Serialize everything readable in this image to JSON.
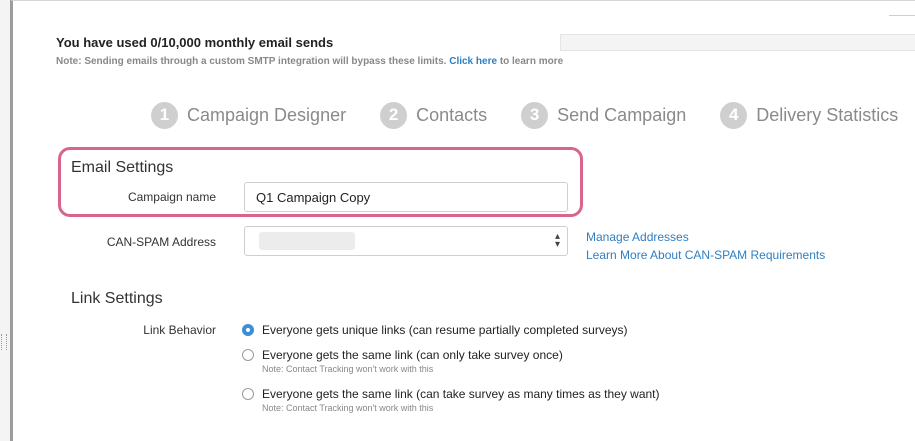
{
  "usage": {
    "title": "You have used 0/10,000 monthly email sends",
    "note_prefix": "Note: Sending emails through a custom SMTP integration will bypass these limits.",
    "note_link": "Click here",
    "note_suffix": "to learn more",
    "progress_fraction": 0.0
  },
  "steps": [
    {
      "number": "1",
      "label": "Campaign Designer"
    },
    {
      "number": "2",
      "label": "Contacts"
    },
    {
      "number": "3",
      "label": "Send Campaign"
    },
    {
      "number": "4",
      "label": "Delivery Statistics"
    }
  ],
  "email_settings": {
    "title": "Email Settings",
    "campaign_name_label": "Campaign name",
    "campaign_name_value": "Q1 Campaign Copy",
    "canspam_label": "CAN-SPAM Address",
    "manage_addresses_link": "Manage Addresses",
    "learn_more_link": "Learn More About CAN-SPAM Requirements"
  },
  "link_settings": {
    "title": "Link Settings",
    "behavior_label": "Link Behavior",
    "options": [
      {
        "text": "Everyone gets unique links (can resume partially completed surveys)",
        "note": "",
        "checked": true
      },
      {
        "text": "Everyone gets the same link (can only take survey once)",
        "note": "Note: Contact Tracking won't work with this",
        "checked": false
      },
      {
        "text": "Everyone gets the same link (can take survey as many times as they want)",
        "note": "Note: Contact Tracking won't work with this",
        "checked": false
      }
    ]
  },
  "colors": {
    "accent": "#3b8ed4",
    "highlight": "#d9658e",
    "link": "#2f7fc1",
    "step_circle": "#cfcfcf"
  }
}
